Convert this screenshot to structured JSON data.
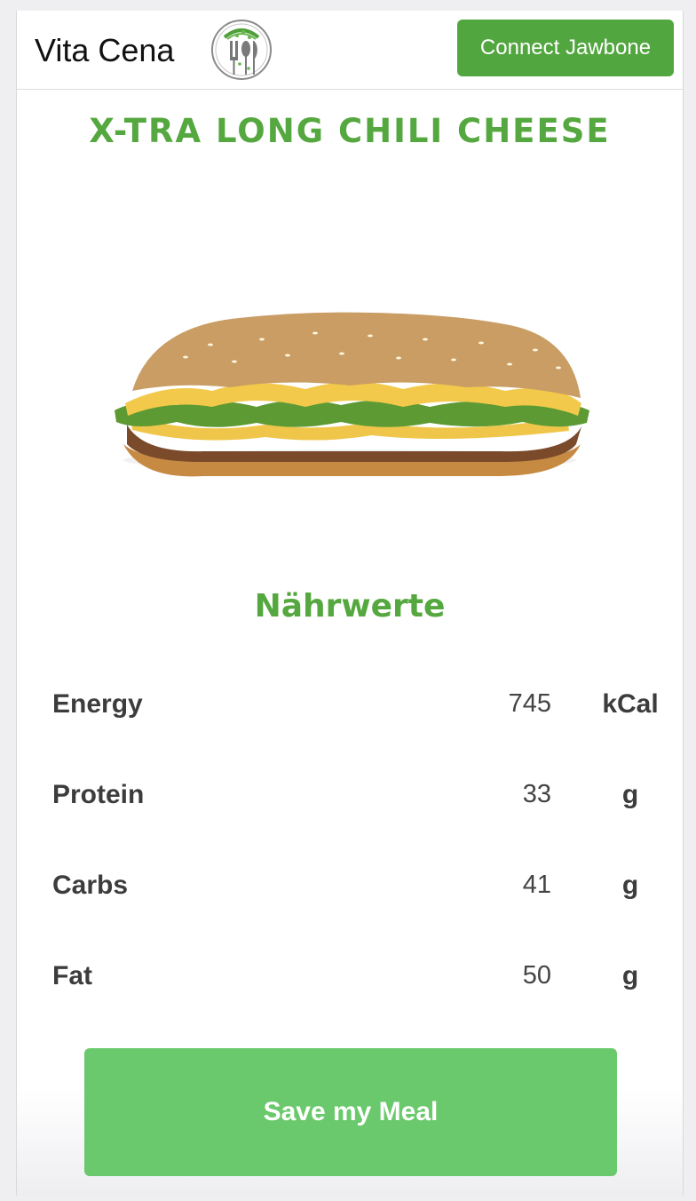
{
  "navbar": {
    "brand": "Vita Cena",
    "connect_label": "Connect Jawbone"
  },
  "meal": {
    "title": "X-TRA LONG CHILI CHEESE"
  },
  "nutrition": {
    "heading": "Nährwerte",
    "rows": [
      {
        "label": "Energy",
        "value": "745",
        "unit": "kCal"
      },
      {
        "label": "Protein",
        "value": "33",
        "unit": "g"
      },
      {
        "label": "Carbs",
        "value": "41",
        "unit": "g"
      },
      {
        "label": "Fat",
        "value": "50",
        "unit": "g"
      }
    ]
  },
  "actions": {
    "save_label": "Save my Meal"
  },
  "colors": {
    "accent_green": "#55a83f",
    "button_green": "#52a63f",
    "save_green": "#6ac96c"
  },
  "icons": {
    "logo": "cutlery-logo-icon"
  }
}
